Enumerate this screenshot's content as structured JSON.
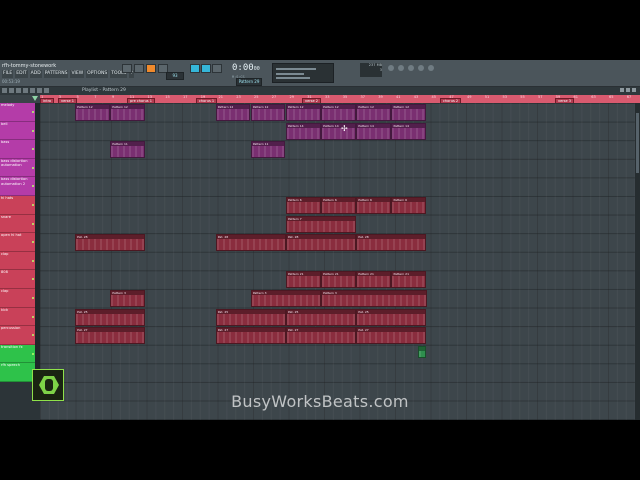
{
  "app": {
    "title": "rfh-tommy-stonework",
    "menu": [
      "FILE",
      "EDIT",
      "ADD",
      "PATTERNS",
      "VIEW",
      "OPTIONS",
      "TOOLS",
      "?"
    ],
    "hint": "00:53:19",
    "time": {
      "main": "0:00",
      "small": "00",
      "sub": "M:S:CS"
    },
    "tempo_label": "Pattern 29",
    "cpu": [
      "237 MB",
      "3"
    ]
  },
  "playlist": {
    "header": "Playlist - Pattern 29",
    "timeline": {
      "bar_numbers": [
        "1",
        "3",
        "5",
        "7",
        "9",
        "11",
        "13",
        "15",
        "17",
        "19",
        "21",
        "23",
        "25",
        "27",
        "29",
        "31",
        "33",
        "35",
        "37",
        "39",
        "41",
        "43",
        "45",
        "47",
        "49",
        "51",
        "53",
        "55",
        "57",
        "59",
        "61",
        "63",
        "65",
        "67",
        "69"
      ],
      "markers": [
        "intro",
        "verse 1",
        "pre chorus 1",
        "chorus 1",
        "verse 2",
        "chorus 2",
        "verse 3"
      ]
    },
    "tracks": [
      {
        "name": "melody",
        "color": "#b43ca8"
      },
      {
        "name": "bell",
        "color": "#b43ca8"
      },
      {
        "name": "bass",
        "color": "#b43ca8"
      },
      {
        "name": "bass distortion automation",
        "color": "#b43ca8"
      },
      {
        "name": "bass distortion automation 2",
        "color": "#b43ca8"
      },
      {
        "name": "hi hats",
        "color": "#c94159"
      },
      {
        "name": "snare",
        "color": "#c94159"
      },
      {
        "name": "open hi hat",
        "color": "#c94159"
      },
      {
        "name": "clap",
        "color": "#c94159"
      },
      {
        "name": "808",
        "color": "#c94159"
      },
      {
        "name": "clap",
        "color": "#c94159"
      },
      {
        "name": "kick",
        "color": "#c94159"
      },
      {
        "name": "percussion",
        "color": "#c94159"
      },
      {
        "name": "transition fx",
        "color": "#2ec24a"
      },
      {
        "name": "rfh speech",
        "color": "#2ec24a"
      }
    ],
    "clips": [
      {
        "track": 0,
        "start": 5,
        "len": 4,
        "label": "Pattern 12",
        "color": "purple"
      },
      {
        "track": 0,
        "start": 9,
        "len": 4,
        "label": "Pattern 12",
        "color": "purple"
      },
      {
        "track": 0,
        "start": 21,
        "len": 4,
        "label": "Pattern 12",
        "color": "purple"
      },
      {
        "track": 0,
        "start": 25,
        "len": 4,
        "label": "Pattern 12",
        "color": "purple"
      },
      {
        "track": 0,
        "start": 29,
        "len": 4,
        "label": "Pattern 12",
        "color": "purple"
      },
      {
        "track": 0,
        "start": 33,
        "len": 4,
        "label": "Pattern 12",
        "color": "purple"
      },
      {
        "track": 0,
        "start": 37,
        "len": 4,
        "label": "Pattern 12",
        "color": "purple"
      },
      {
        "track": 0,
        "start": 41,
        "len": 4,
        "label": "Pattern 12",
        "color": "purple"
      },
      {
        "track": 1,
        "start": 29,
        "len": 4,
        "label": "Pattern 14",
        "color": "purple"
      },
      {
        "track": 1,
        "start": 33,
        "len": 4,
        "label": "Pattern 14",
        "color": "purple"
      },
      {
        "track": 1,
        "start": 37,
        "len": 4,
        "label": "Pattern 14",
        "color": "purple"
      },
      {
        "track": 1,
        "start": 41,
        "len": 4,
        "label": "Pattern 14",
        "color": "purple"
      },
      {
        "track": 2,
        "start": 9,
        "len": 4,
        "label": "Pattern 11",
        "color": "purple"
      },
      {
        "track": 2,
        "start": 25,
        "len": 4,
        "label": "Pattern 11",
        "color": "purple"
      },
      {
        "track": 5,
        "start": 29,
        "len": 4,
        "label": "Pattern 6",
        "color": "red"
      },
      {
        "track": 5,
        "start": 33,
        "len": 4,
        "label": "Pattern 6",
        "color": "red"
      },
      {
        "track": 5,
        "start": 37,
        "len": 4,
        "label": "Pattern 6",
        "color": "red"
      },
      {
        "track": 5,
        "start": 41,
        "len": 4,
        "label": "Pattern 6",
        "color": "red"
      },
      {
        "track": 6,
        "start": 29,
        "len": 8,
        "label": "Pattern 7",
        "color": "red"
      },
      {
        "track": 7,
        "start": 5,
        "len": 8,
        "label": "Pat. 28",
        "color": "red"
      },
      {
        "track": 7,
        "start": 21,
        "len": 8,
        "label": "Pat. 28",
        "color": "red"
      },
      {
        "track": 7,
        "start": 29,
        "len": 8,
        "label": "Pat. 28",
        "color": "red"
      },
      {
        "track": 7,
        "start": 37,
        "len": 8,
        "label": "Pat. 28",
        "color": "red"
      },
      {
        "track": 9,
        "start": 29,
        "len": 4,
        "label": "Pattern 21",
        "color": "red"
      },
      {
        "track": 9,
        "start": 33,
        "len": 4,
        "label": "Pattern 21",
        "color": "red"
      },
      {
        "track": 9,
        "start": 37,
        "len": 4,
        "label": "Pattern 21",
        "color": "red"
      },
      {
        "track": 9,
        "start": 41,
        "len": 4,
        "label": "Pattern 21",
        "color": "red"
      },
      {
        "track": 10,
        "start": 9,
        "len": 4,
        "label": "Pattern 3",
        "color": "red"
      },
      {
        "track": 10,
        "start": 25,
        "len": 8,
        "label": "Pattern 3",
        "color": "red"
      },
      {
        "track": 10,
        "start": 33,
        "len": 12,
        "label": "Pattern 3",
        "color": "red"
      },
      {
        "track": 11,
        "start": 5,
        "len": 8,
        "label": "Pat. 25",
        "color": "red"
      },
      {
        "track": 11,
        "start": 21,
        "len": 8,
        "label": "Pat. 25",
        "color": "red"
      },
      {
        "track": 11,
        "start": 29,
        "len": 8,
        "label": "Pat. 25",
        "color": "red"
      },
      {
        "track": 11,
        "start": 37,
        "len": 8,
        "label": "Pat. 25",
        "color": "red"
      },
      {
        "track": 12,
        "start": 5,
        "len": 8,
        "label": "Pat. 27",
        "color": "red"
      },
      {
        "track": 12,
        "start": 21,
        "len": 8,
        "label": "Pat. 27",
        "color": "red"
      },
      {
        "track": 12,
        "start": 29,
        "len": 8,
        "label": "Pat. 27",
        "color": "red"
      },
      {
        "track": 12,
        "start": 37,
        "len": 8,
        "label": "Pat. 27",
        "color": "red"
      },
      {
        "track": 13,
        "start": 44,
        "len": 1,
        "label": "",
        "color": "green"
      }
    ]
  },
  "watermark": "BusyWorksBeats.com",
  "icons": [
    "play-icon",
    "stop-icon",
    "record-icon",
    "snap-icon",
    "cursor-icon",
    "bee-logo-icon"
  ]
}
